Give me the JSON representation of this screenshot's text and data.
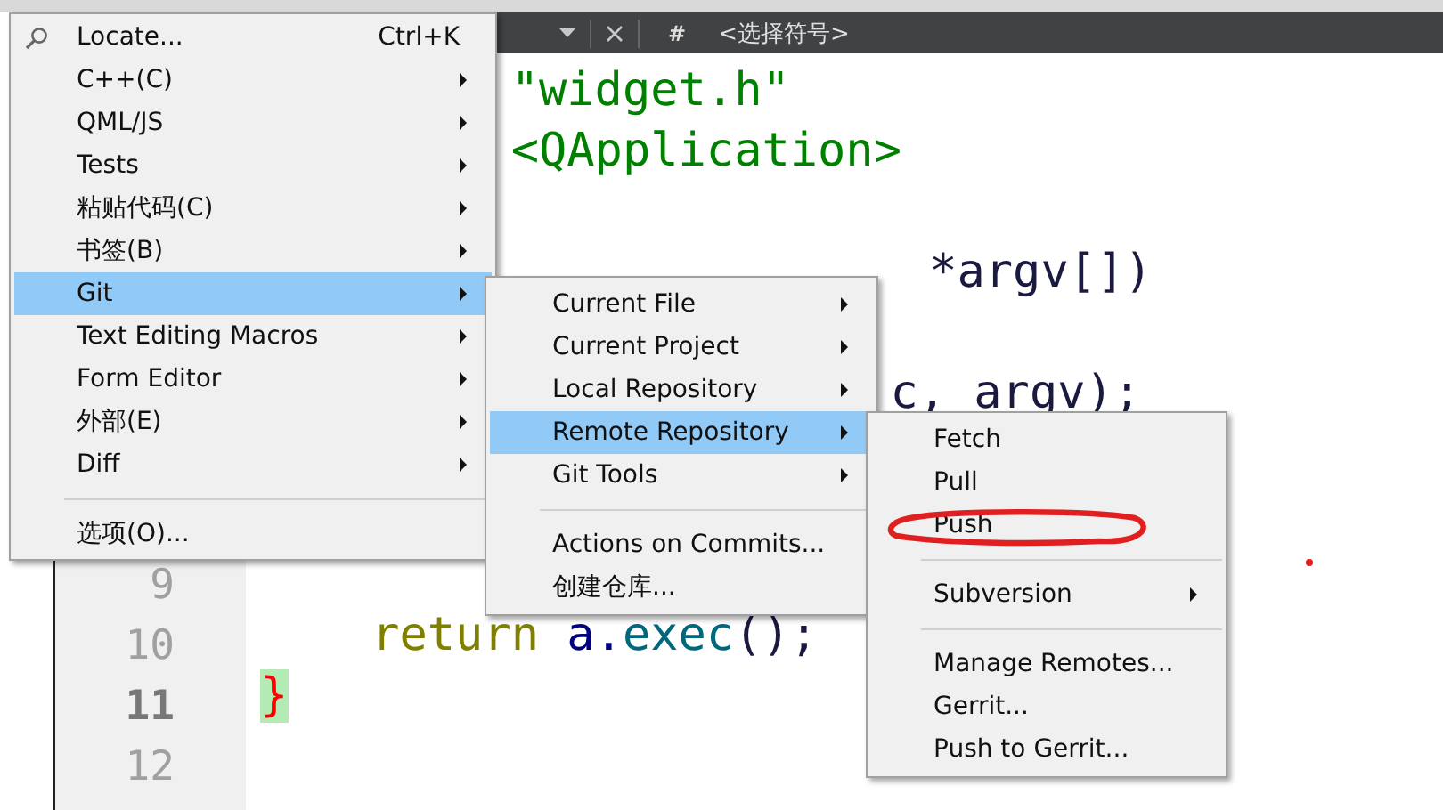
{
  "toolbar": {
    "hash": "#",
    "symbol_selector": "<选择符号>"
  },
  "editor": {
    "lines": [
      {
        "kind": "include",
        "text": "\"widget.h\""
      },
      {
        "kind": "include",
        "text": "<QApplication>"
      },
      {
        "kind": "plain",
        "text": "*argv[])"
      },
      {
        "kind": "plain",
        "text": "c, argv);"
      },
      {
        "kind": "return",
        "keyword": "return",
        "object": "a.",
        "call": "exec",
        "rest": "();"
      },
      {
        "kind": "brace",
        "text": "}"
      }
    ],
    "line_numbers": [
      {
        "text": "9",
        "current": false
      },
      {
        "text": "10",
        "current": false
      },
      {
        "text": "11",
        "current": true
      },
      {
        "text": "12",
        "current": false
      }
    ]
  },
  "main_menu": {
    "items": [
      {
        "kind": "action",
        "label": "Locate...",
        "shortcut": "Ctrl+K",
        "icon": true,
        "selected": false
      },
      {
        "kind": "submenu",
        "label": "C++(C)",
        "selected": false
      },
      {
        "kind": "submenu",
        "label": "QML/JS",
        "selected": false
      },
      {
        "kind": "submenu",
        "label": "Tests",
        "selected": false
      },
      {
        "kind": "submenu",
        "label": "粘贴代码(C)",
        "selected": false
      },
      {
        "kind": "submenu",
        "label": "书签(B)",
        "selected": false
      },
      {
        "kind": "submenu",
        "label": "Git",
        "selected": true
      },
      {
        "kind": "submenu",
        "label": "Text Editing Macros",
        "selected": false
      },
      {
        "kind": "submenu",
        "label": "Form Editor",
        "selected": false
      },
      {
        "kind": "submenu",
        "label": "外部(E)",
        "selected": false
      },
      {
        "kind": "submenu",
        "label": "Diff",
        "selected": false
      },
      {
        "kind": "separator"
      },
      {
        "kind": "action",
        "label": "选项(O)...",
        "selected": false
      }
    ]
  },
  "git_menu": {
    "items": [
      {
        "kind": "submenu",
        "label": "Current File",
        "selected": false
      },
      {
        "kind": "submenu",
        "label": "Current Project",
        "selected": false
      },
      {
        "kind": "submenu",
        "label": "Local Repository",
        "selected": false
      },
      {
        "kind": "submenu",
        "label": "Remote Repository",
        "selected": true
      },
      {
        "kind": "submenu",
        "label": "Git Tools",
        "selected": false
      },
      {
        "kind": "separator"
      },
      {
        "kind": "action",
        "label": "Actions on Commits...",
        "selected": false
      },
      {
        "kind": "action",
        "label": "创建仓库...",
        "selected": false
      }
    ]
  },
  "remote_menu": {
    "items": [
      {
        "kind": "action",
        "label": "Fetch",
        "selected": false
      },
      {
        "kind": "action",
        "label": "Pull",
        "selected": false
      },
      {
        "kind": "action",
        "label": "Push",
        "selected": false,
        "circled": true
      },
      {
        "kind": "separator"
      },
      {
        "kind": "submenu",
        "label": "Subversion",
        "selected": false
      },
      {
        "kind": "separator"
      },
      {
        "kind": "action",
        "label": "Manage Remotes...",
        "selected": false
      },
      {
        "kind": "action",
        "label": "Gerrit...",
        "selected": false
      },
      {
        "kind": "action",
        "label": "Push to Gerrit...",
        "selected": false
      }
    ]
  }
}
